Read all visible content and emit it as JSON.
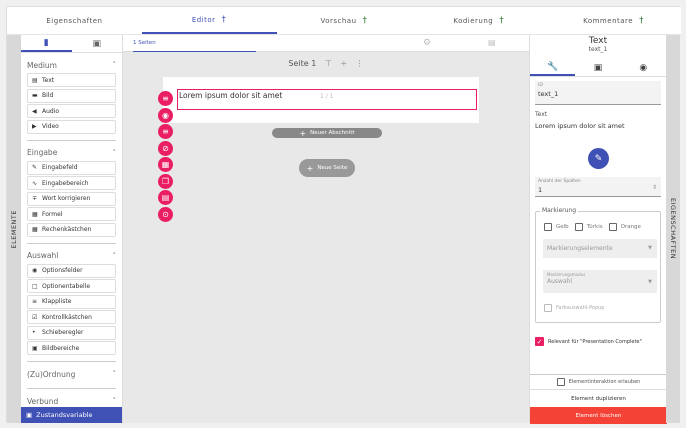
{
  "tabs": [
    {
      "label": "Eigenschaften",
      "pinned": false,
      "active": false
    },
    {
      "label": "Editor",
      "pinned": true,
      "active": true
    },
    {
      "label": "Vorschau",
      "pinned": true,
      "active": false
    },
    {
      "label": "Kodierung",
      "pinned": true,
      "active": false
    },
    {
      "label": "Kommentare",
      "pinned": true,
      "active": false
    }
  ],
  "pin_icon": "†",
  "left_strip": "ELEMENTE",
  "right_strip": "EIGENSCHAFTEN",
  "elements": {
    "groups": [
      {
        "title": "Medium",
        "items": [
          {
            "icon": "▤",
            "label": "Text"
          },
          {
            "icon": "▬",
            "label": "Bild"
          },
          {
            "icon": "◀",
            "label": "Audio"
          },
          {
            "icon": "▶",
            "label": "Video"
          }
        ]
      },
      {
        "title": "Eingabe",
        "items": [
          {
            "icon": "✎",
            "label": "Eingabefeld"
          },
          {
            "icon": "∿",
            "label": "Eingabebereich"
          },
          {
            "icon": "∓",
            "label": "Wort korrigieren"
          },
          {
            "icon": "▦",
            "label": "Formel"
          },
          {
            "icon": "▦",
            "label": "Rechenkästchen"
          }
        ]
      },
      {
        "title": "Auswahl",
        "items": [
          {
            "icon": "◉",
            "label": "Optionsfelder"
          },
          {
            "icon": "□",
            "label": "Optionentabelle"
          },
          {
            "icon": "≡",
            "label": "Klappliste"
          },
          {
            "icon": "☑",
            "label": "Kontrollkästchen"
          },
          {
            "icon": "•",
            "label": "Schieberegler"
          },
          {
            "icon": "▣",
            "label": "Bildbereiche"
          }
        ]
      },
      {
        "title": "(Zu)Ordnung",
        "items": []
      },
      {
        "title": "Verbund",
        "items": []
      }
    ],
    "zustand": "Zustandsvariable"
  },
  "editor": {
    "sections_tab": "1 Seiten",
    "page_title": "Seite 1",
    "text_element": "Lorem ipsum dolor sit amet",
    "text_counter": "1 / 1",
    "new_section": "Neuer Abschnitt",
    "new_page": "Neue Seite"
  },
  "props": {
    "title": "Text",
    "subtitle": "text_1",
    "id_label": "ID",
    "id_value": "text_1",
    "text_label": "Text",
    "text_value": "Lorem ipsum dolor sit amet",
    "spalten_label": "Anzahl der Spalten",
    "spalten_value": "1",
    "markierung": "Markierung",
    "colors": [
      "Gelb",
      "Türkis",
      "Orange"
    ],
    "markierungselemente": "Markierungselemente",
    "mode_label": "Markierungsmodus",
    "mode_value": "Auswahl",
    "farbauswahl": "Farbauswahl-Popup",
    "relevant": "Relevant für \"Presentation Complete\"",
    "interaktion": "Elementinteraktion erlauben",
    "duplizieren": "Element duplizieren",
    "loeschen": "Element löschen"
  },
  "accent": "#3f51b5",
  "pink": "#e91e63",
  "delete_color": "#f44336"
}
